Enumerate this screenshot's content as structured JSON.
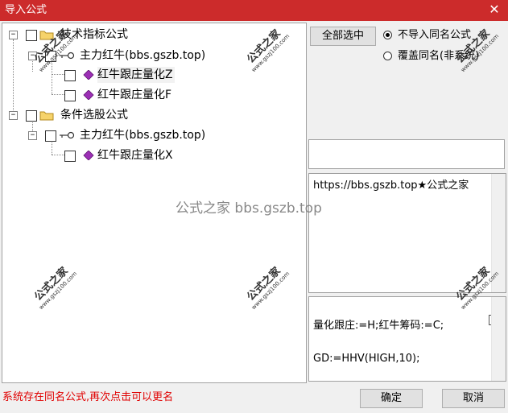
{
  "window": {
    "title": "导入公式",
    "close_glyph": "✕"
  },
  "tree": [
    {
      "expander": "−",
      "label": "技术指标公式",
      "icon": "folder-icon"
    },
    {
      "expander": "−",
      "label": "主力红牛(bbs.gszb.top)",
      "icon": "key-icon"
    },
    {
      "label": "红牛跟庄量化Z",
      "icon": "formula-diamond-icon"
    },
    {
      "label": "红牛跟庄量化F",
      "icon": "formula-diamond-icon"
    },
    {
      "expander": "−",
      "label": "条件选股公式",
      "icon": "folder-icon"
    },
    {
      "expander": "−",
      "label": "主力红牛(bbs.gszb.top)",
      "icon": "key-icon"
    },
    {
      "label": "红牛跟庄量化X",
      "icon": "formula-diamond-icon"
    }
  ],
  "controls": {
    "select_all": "全部选中",
    "radio_skip": "不导入同名公式",
    "radio_overwrite": "覆盖同名(非系统)",
    "ok": "确定",
    "cancel": "取消"
  },
  "info_text": "https://bbs.gszb.top★公式之家",
  "code_lines": [
    "量化跟庄:=H;红牛筹码:=C;",
    "GD:=HHV(HIGH,10);"
  ],
  "status": "系统存在同名公式,再次点击可以更名",
  "watermark": {
    "main": "公式之家",
    "url": "www.gszj100.com",
    "center": "公式之家 bbs.gszb.top"
  },
  "colors": {
    "titlebar": "#cc2b2b",
    "status_text": "#e00000",
    "diamond": "#9b2fb5"
  }
}
